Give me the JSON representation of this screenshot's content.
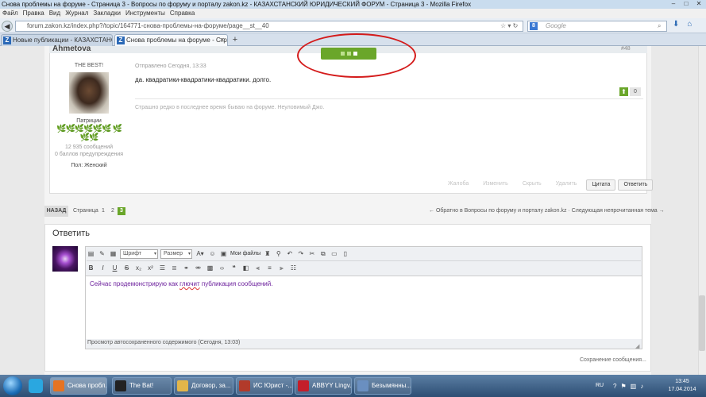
{
  "window": {
    "title": "Снова проблемы на форуме - Страница 3 - Вопросы по форуму и порталу zakon.kz - КАЗАХСТАНСКИЙ ЮРИДИЧЕСКИЙ ФОРУМ - Страница 3 - Mozilla Firefox"
  },
  "menu": [
    "Файл",
    "Правка",
    "Вид",
    "Журнал",
    "Закладки",
    "Инструменты",
    "Справка"
  ],
  "nav": {
    "url": "forum.zakon.kz/index.php?/topic/164771-снова-проблемы-на-форуме/page__st__40",
    "search_placeholder": "Google",
    "search_engine_icon": "google-icon"
  },
  "tabs": [
    {
      "label": "Новые публикации - КАЗАХСТАНС...",
      "active": false
    },
    {
      "label": "Снова проблемы на форуме - Стра...",
      "active": true
    }
  ],
  "post": {
    "author": "Ahmetova",
    "number": "#48",
    "rank": "THE BEST!",
    "group": "Патриции",
    "leaves": "🌿🌿🌿🌿🌿🌿 🌿🌿🌿",
    "post_count": "12 935 сообщений",
    "warnings": "0 баллов предупреждения",
    "gender": "Пол: Женский",
    "posted": "Отправлено Сегодня, 13:33",
    "message": "да. квадратики-квадратики-квадратики. долго.",
    "reputation": "0",
    "signature": "Страшно редко в последнее время бываю на форуме. Неуловимый Джо.",
    "actions": [
      "Жалоба",
      "Изменить",
      "Скрыть",
      "Удалить"
    ],
    "quote_label": "Цитата",
    "reply_label": "Ответить"
  },
  "pagination": {
    "back_label": "НАЗАД",
    "page_label": "Страница",
    "pages": [
      "1",
      "2",
      "3"
    ],
    "current": "3",
    "back_to_forum": "← Обратно в Вопросы по форуму и порталу zakon.kz · Следующая непрочитанная тема →"
  },
  "reply": {
    "title": "Ответить",
    "font_select": "Шрифт",
    "size_select": "Размер",
    "my_files_label": "Мои файлы",
    "text": "Сейчас продемонстрирую как ",
    "text_misspelled": "глючит",
    "text_end": " публикация сообщений.",
    "autosave": "Просмотр автосохраненного содержимого (Сегодня, 13:03)",
    "save_status": "Сохранение сообщения..."
  },
  "taskbar": {
    "items": [
      {
        "label": "Снова пробл...",
        "color": "#e57322"
      },
      {
        "label": "The Bat!",
        "color": "#222222"
      },
      {
        "label": "Договор, за...",
        "color": "#e3b64a"
      },
      {
        "label": "ИС Юрист -...",
        "color": "#b23a2a"
      },
      {
        "label": "ABBYY Lingv...",
        "color": "#c41e2a"
      },
      {
        "label": "Безымянны...",
        "color": "#6a8fc0"
      }
    ],
    "lang": "RU",
    "time": "13:45",
    "date": "17.04.2014"
  },
  "colors": {
    "accent_green": "#6aa62a",
    "annotation_red": "#d41b1b"
  }
}
